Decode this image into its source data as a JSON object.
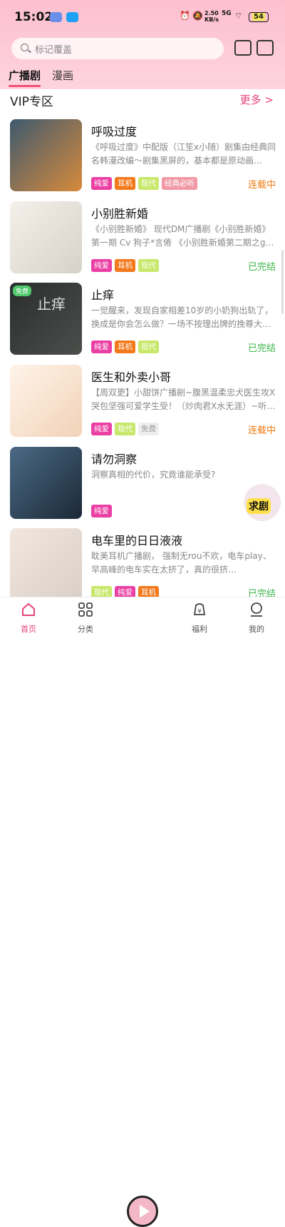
{
  "status": {
    "time": "15:02",
    "net_speed": "2.50",
    "net_unit": "KB/s",
    "signal": "5G",
    "battery": "54"
  },
  "search": {
    "placeholder": "标记覆盖"
  },
  "tabs": [
    "广播剧",
    "漫画"
  ],
  "section": {
    "title": "VIP专区",
    "more": "更多"
  },
  "items": [
    {
      "title": "呼吸过度",
      "desc": "《呼吸过度》中配版（江笙x小随）剧集由经典同名韩漫改编～剧集黑屏的，基本都是原动画…",
      "tags": [
        "纯爱",
        "耳机",
        "现代",
        "经典必听"
      ],
      "status": "连载中"
    },
    {
      "title": "小别胜新婚",
      "desc": "《小别胜新婚》 现代DM广播剧《小别胜新婚》第一期 Cv 狗子*言倦 《小别胜新婚第二期之g…",
      "tags": [
        "纯爱",
        "耳机",
        "现代"
      ],
      "status": "已完结"
    },
    {
      "title": "止痒",
      "desc": "一觉醒来，发现自家相差10岁的小奶狗出轨了，换成是你会怎么做？一场不按理出牌的挽尊大…",
      "tags": [
        "纯爱",
        "耳机",
        "现代"
      ],
      "status": "已完结",
      "badge": "免费",
      "thumb_text": "止痒"
    },
    {
      "title": "医生和外卖小哥",
      "desc": "【周双更】小甜饼广播剧~腹黑温柔忠犬医生攻X哭包坚强可爱学生受！（炒肉君X水无涯）~听…",
      "tags": [
        "纯爱",
        "现代",
        "免费"
      ],
      "status": "连载中"
    },
    {
      "title": "请勿洞察",
      "desc": "洞察真相的代价，究竟谁能承受?",
      "tags": [
        "纯爱"
      ],
      "status": ""
    },
    {
      "title": "电车里的日日液液",
      "desc": "耽美耳机广播剧， 强制无rou不欢，电车play、 早高峰的电车实在太挤了，真的很挤…",
      "tags": [
        "现代",
        "纯爱",
        "耳机"
      ],
      "status": "已完结"
    }
  ],
  "float_button": "求剧",
  "nav": [
    "首页",
    "分类",
    "福利",
    "我的"
  ],
  "colors": {
    "accent": "#e8447a",
    "ongoing": "#ee7a10",
    "finished": "#3bb64a",
    "tag_pure": "#ea3fa3",
    "tag_headphone": "#f2791c",
    "tag_modern": "#c8e86c",
    "tag_classic": "#f19aa6",
    "tag_free": "#eeeeee"
  }
}
